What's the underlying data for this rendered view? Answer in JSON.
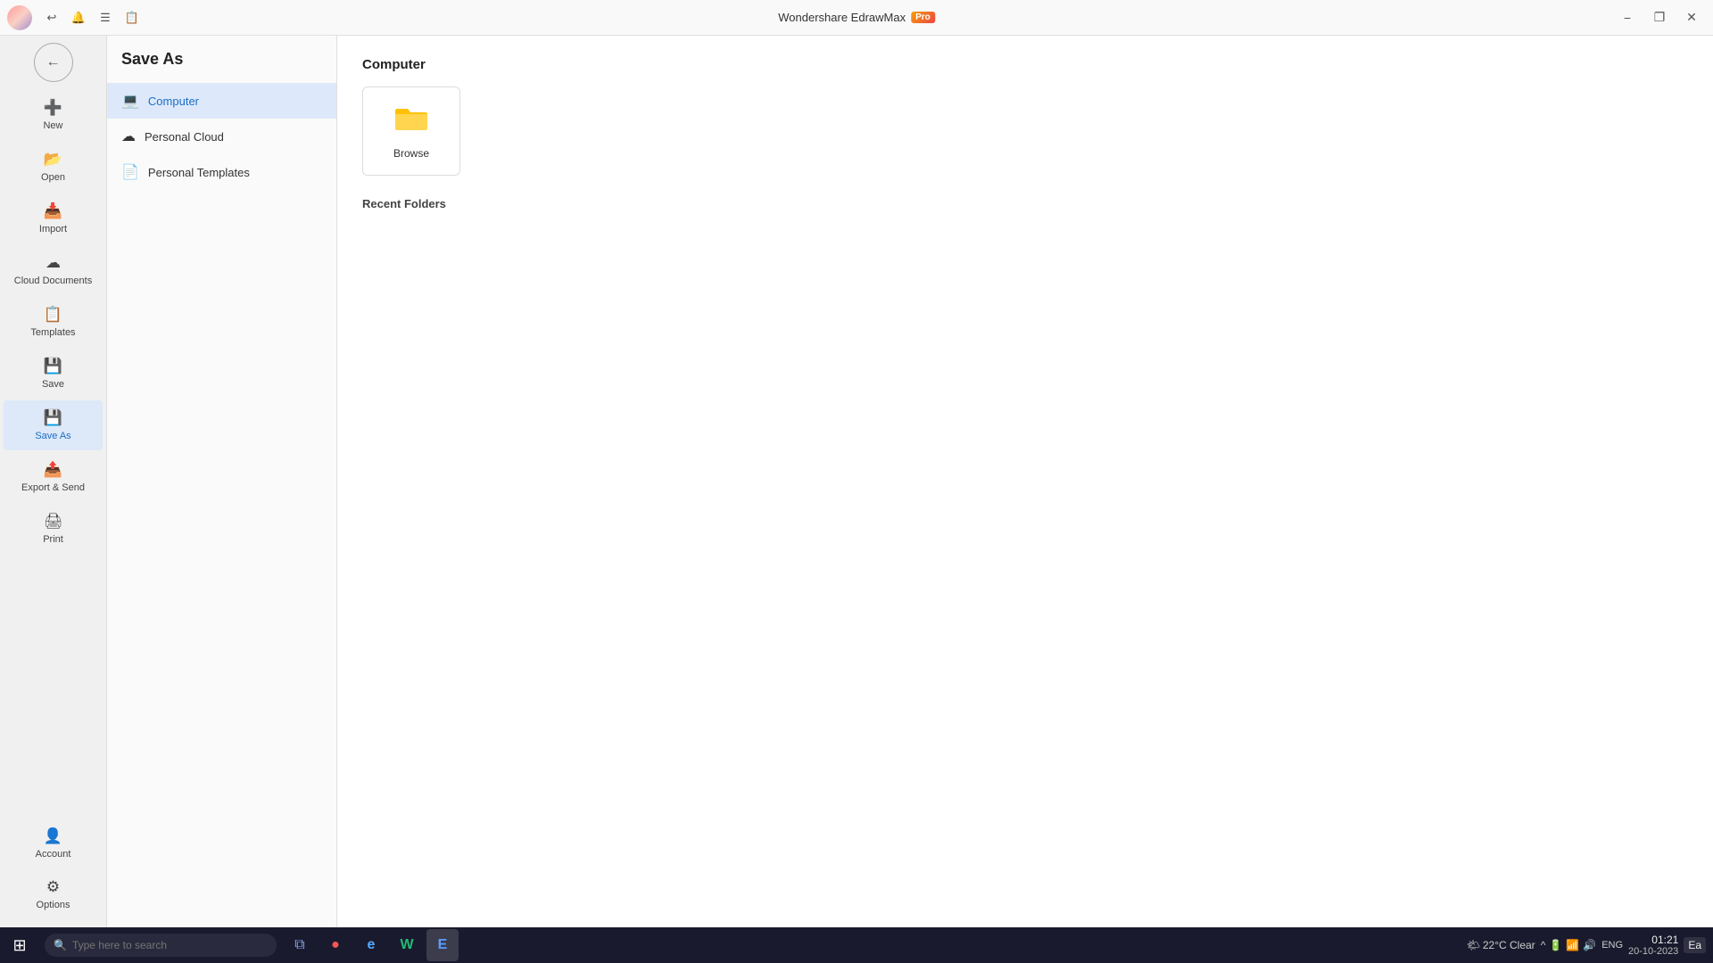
{
  "app": {
    "title": "Wondershare EdrawMax",
    "badge": "Pro"
  },
  "titlebar": {
    "minimize_label": "−",
    "restore_label": "❐",
    "close_label": "✕",
    "toolbar_icons": [
      "↩",
      "🔔",
      "☰",
      "📋"
    ]
  },
  "sidebar": {
    "back_label": "←",
    "items": [
      {
        "id": "new",
        "label": "New",
        "icon": "➕"
      },
      {
        "id": "open",
        "label": "Open",
        "icon": "📂"
      },
      {
        "id": "import",
        "label": "Import",
        "icon": "📥"
      },
      {
        "id": "cloud",
        "label": "Cloud Documents",
        "icon": "☁"
      },
      {
        "id": "templates",
        "label": "Templates",
        "icon": "📋"
      },
      {
        "id": "save",
        "label": "Save",
        "icon": "💾"
      },
      {
        "id": "saveas",
        "label": "Save As",
        "icon": "💾",
        "active": true
      },
      {
        "id": "export",
        "label": "Export & Send",
        "icon": "📤"
      },
      {
        "id": "print",
        "label": "Print",
        "icon": "🖨"
      }
    ],
    "bottom_items": [
      {
        "id": "account",
        "label": "Account",
        "icon": "👤"
      },
      {
        "id": "options",
        "label": "Options",
        "icon": "⚙"
      }
    ]
  },
  "save_as_panel": {
    "title": "Save As",
    "options": [
      {
        "id": "computer",
        "label": "Computer",
        "icon": "💻",
        "active": true
      },
      {
        "id": "personal_cloud",
        "label": "Personal Cloud",
        "icon": "☁"
      },
      {
        "id": "personal_templates",
        "label": "Personal Templates",
        "icon": "📄"
      }
    ]
  },
  "main": {
    "section_title": "Computer",
    "browse_label": "Browse",
    "recent_title": "Recent Folders"
  },
  "taskbar": {
    "start_icon": "⊞",
    "search_placeholder": "Type here to search",
    "apps": [
      {
        "id": "task-view",
        "icon": "⧉"
      },
      {
        "id": "chrome",
        "icon": "●"
      },
      {
        "id": "edge",
        "icon": "e"
      },
      {
        "id": "word",
        "icon": "W"
      },
      {
        "id": "edraw",
        "icon": "E"
      }
    ],
    "weather": "22°C  Clear",
    "sys_icons": [
      "^",
      "🔋",
      "📶",
      "🔊"
    ],
    "lang": "ENG",
    "time": "01:21",
    "date": "20-10-2023",
    "ea_label": "Ea"
  }
}
